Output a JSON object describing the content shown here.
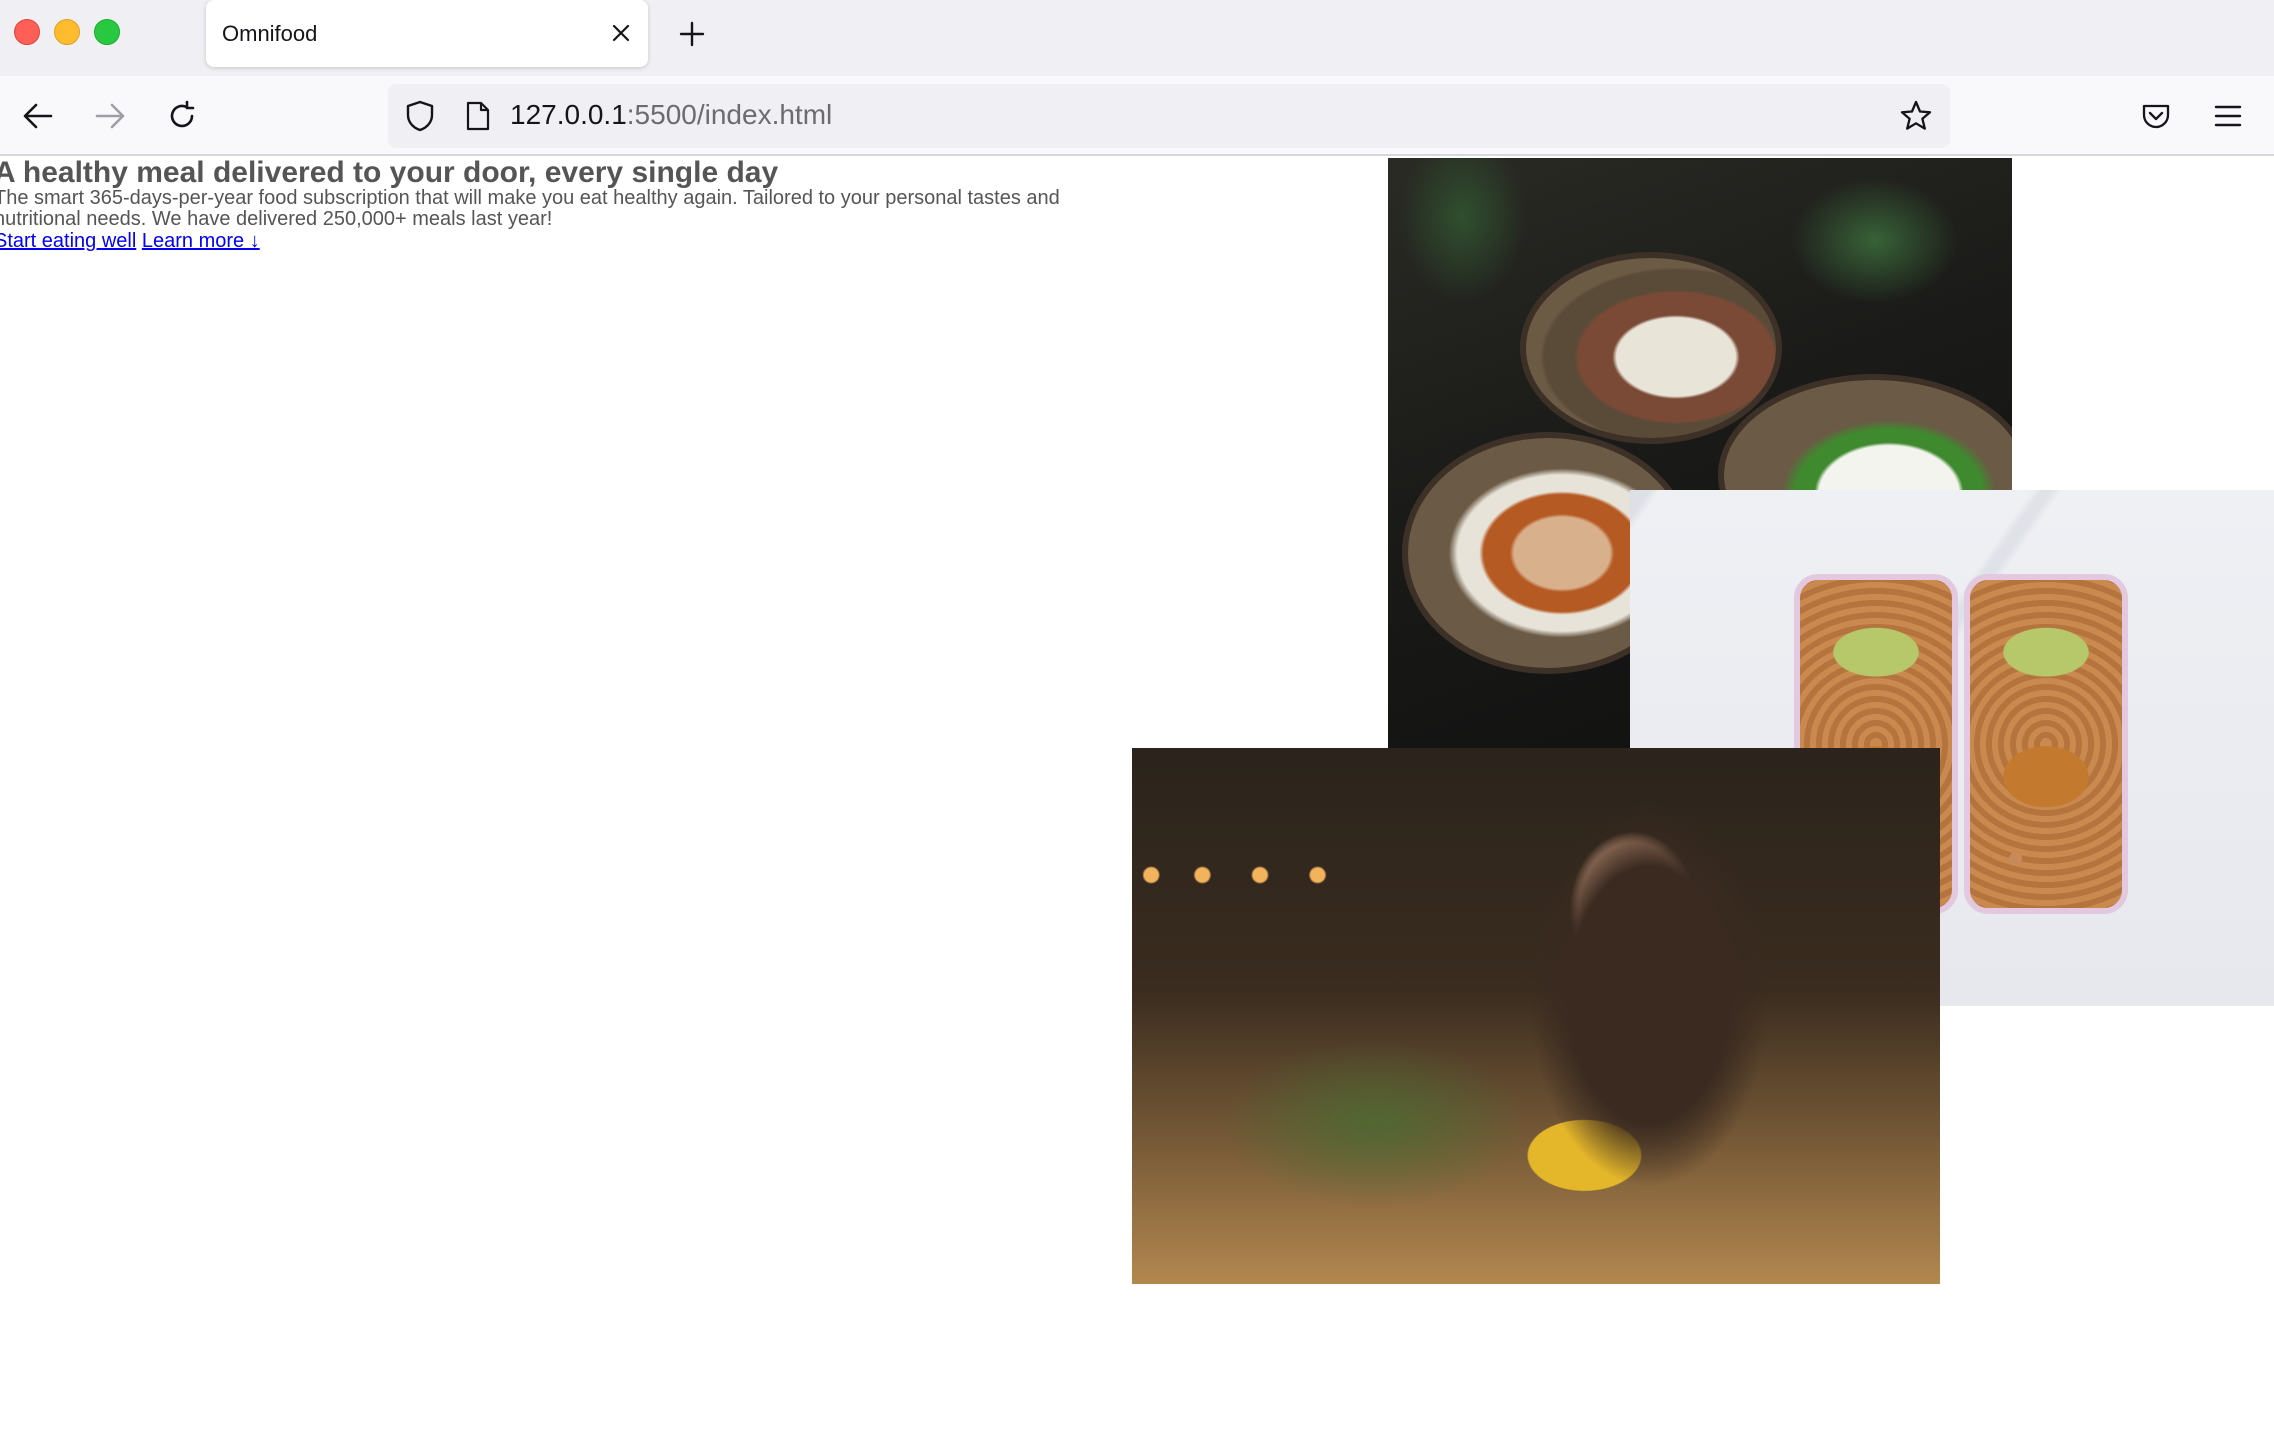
{
  "browser": {
    "tab": {
      "title": "Omnifood"
    },
    "url": {
      "host": "127.0.0.1",
      "rest": ":5500/index.html"
    },
    "icons": {
      "close": "close-icon",
      "new_tab": "plus-icon",
      "back": "arrow-left-icon",
      "forward": "arrow-right-icon",
      "reload": "reload-icon",
      "shield": "shield-icon",
      "page": "page-icon",
      "bookmark": "star-icon",
      "pocket": "pocket-icon",
      "menu": "hamburger-menu-icon"
    }
  },
  "hero": {
    "title": "A healthy meal delivered to your door, every single day",
    "description": "The smart 365-days-per-year food subscription that will make you eat healthy again. Tailored to your personal tastes and nutritional needs. We have delivered 250,000+ meals last year!",
    "cta_primary": "Start eating well",
    "cta_secondary": "Learn more ↓"
  },
  "colors": {
    "text": "#555555",
    "link": "#0000ee",
    "chrome_bg": "#f0f0f4",
    "nav_bg": "#f9f9fb"
  }
}
